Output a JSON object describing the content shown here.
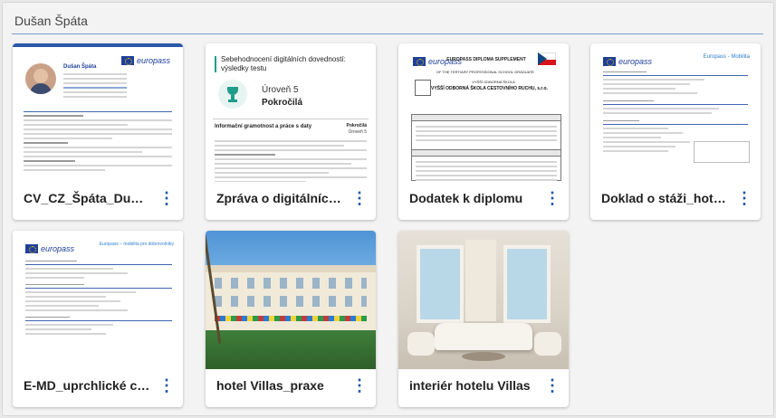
{
  "folder": {
    "title": "Dušan Špáta"
  },
  "cards": [
    {
      "caption": "CV_CZ_Špáta_Duša…",
      "thumb_kind": "cv-europass",
      "brand": "europass",
      "person": "Dušan Špáta"
    },
    {
      "caption": "Zpráva o digitálních…",
      "thumb_kind": "digital-report",
      "report_title": "Sebehodnocení digitálních dovedností: výsledky testu",
      "level": "Úroveň 5",
      "level_name": "Pokročilá",
      "section": "Informační gramotnost a práce s daty",
      "section_level": "Pokročilá",
      "section_level_num": "Úroveň 5"
    },
    {
      "caption": "Dodatek k diplomu",
      "thumb_kind": "diploma-supplement",
      "brand": "europass",
      "heading1": "EUROPASS DIPLOMA SUPPLEMENT",
      "heading2": "OF THE TERTIARY PROFESSIONAL SCHOOL GRADUATE",
      "school_small": "VYŠŠÍ ODBORNÁ ŠKOLA",
      "school": "VYŠŠÍ ODBORNÁ ŠKOLA CESTOVNÍHO RUCHU, s.r.o."
    },
    {
      "caption": "Doklad o stáži_hote…",
      "thumb_kind": "mobility-doc",
      "brand": "europass",
      "mobility": "Europass - Mobilita"
    },
    {
      "caption": "E-MD_uprchlické ce…",
      "thumb_kind": "mobility-doc2",
      "brand": "europass",
      "mobility": "Europass – mobilita pro dobrovolníky"
    },
    {
      "caption": "hotel Villas_praxe",
      "thumb_kind": "photo-hotel"
    },
    {
      "caption": "interiér hotelu Villas",
      "thumb_kind": "photo-interior"
    }
  ],
  "menu_glyph": "⋮",
  "colors": {
    "accent": "#1a56a8",
    "rule": "#7b9bd0",
    "europass_blue": "#1f3f9b",
    "teal": "#1f9d8a"
  }
}
